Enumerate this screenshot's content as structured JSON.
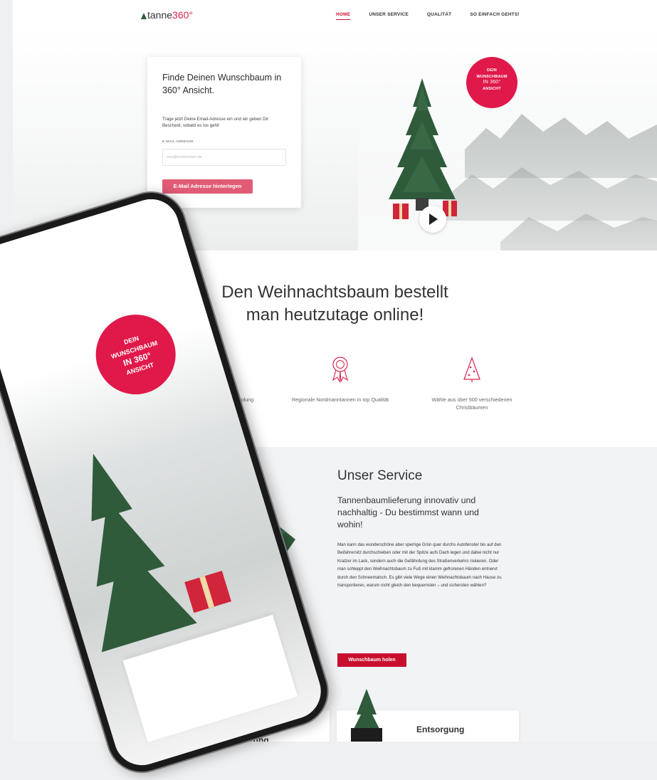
{
  "header": {
    "logo_main": "tanne",
    "logo_accent": "360°",
    "nav": [
      {
        "label": "HOME",
        "active": true
      },
      {
        "label": "UNSER SERVICE",
        "active": false
      },
      {
        "label": "QUALITÄT",
        "active": false
      },
      {
        "label": "SO EINFACH GEHTS!",
        "active": false
      }
    ]
  },
  "hero": {
    "title": "Finde Deinen Wunschbaum in 360° Ansicht.",
    "text": "Trage jetzt Deine Email-Adresse ein und wir geben Dir Bescheid, sobald es los geht!",
    "email_label": "E-MAIL ADRESSE",
    "email_placeholder": "max@mustermann.de",
    "button": "E-Mail Adresse hinterlegen",
    "badge_line1": "DEIN",
    "badge_line2": "WUNSCHBAUM",
    "badge_line3": "IN 360°",
    "badge_line4": "ANSICHT"
  },
  "intro": {
    "line1": "Den Weihnachtsbaum bestellt",
    "line2": "man heutzutage online!"
  },
  "features": [
    {
      "icon": "phone-icon",
      "text": "Full Service von Lieferung bis Abholung"
    },
    {
      "icon": "award-ribbon-icon",
      "text": "Regionale Nordmanntannen in top Qualität"
    },
    {
      "icon": "christmas-tree-icon",
      "text": "Wähle aus über 500 verschiedenen Christbäumen"
    }
  ],
  "service": {
    "heading": "Unser Service",
    "subheading": "Tannenbaumlieferung innovativ und nachhaltig - Du bestimmst wann und wohin!",
    "body": "Man kann das wunderschöne aber sperrige Grün quer durchs Autofenster bis auf den Beifahrersitz durchschieben oder mit der Spitze aufs Dach legen und dabei nicht nur Kratzer im Lack, sondern auch die Gefährdung des Straßenverkehrs riskieren. Oder man schleppt den Weihnachtsbaum zu Fuß mit klamm gefrorenen Händen entnervt durch den Schneematsch. Es gibt viele Wege einen Weihnachtsbaum nach Hause zu transportieren, warum nicht gleich den bequemsten – und sichersten wählen?",
    "button": "Wunschbaum holen",
    "cards": [
      {
        "title": "Kostenlose Lieferung"
      },
      {
        "title": "Entsorgung"
      }
    ]
  },
  "phone": {
    "badge_line1": "DEIN",
    "badge_line2": "WUNSCHBAUM",
    "badge_line3": "IN 360°",
    "badge_line4": "ANSICHT"
  },
  "colors": {
    "accent": "#c8102e",
    "badge": "#e0194a",
    "button_light": "#e05c74",
    "tree": "#2f5b3b"
  }
}
